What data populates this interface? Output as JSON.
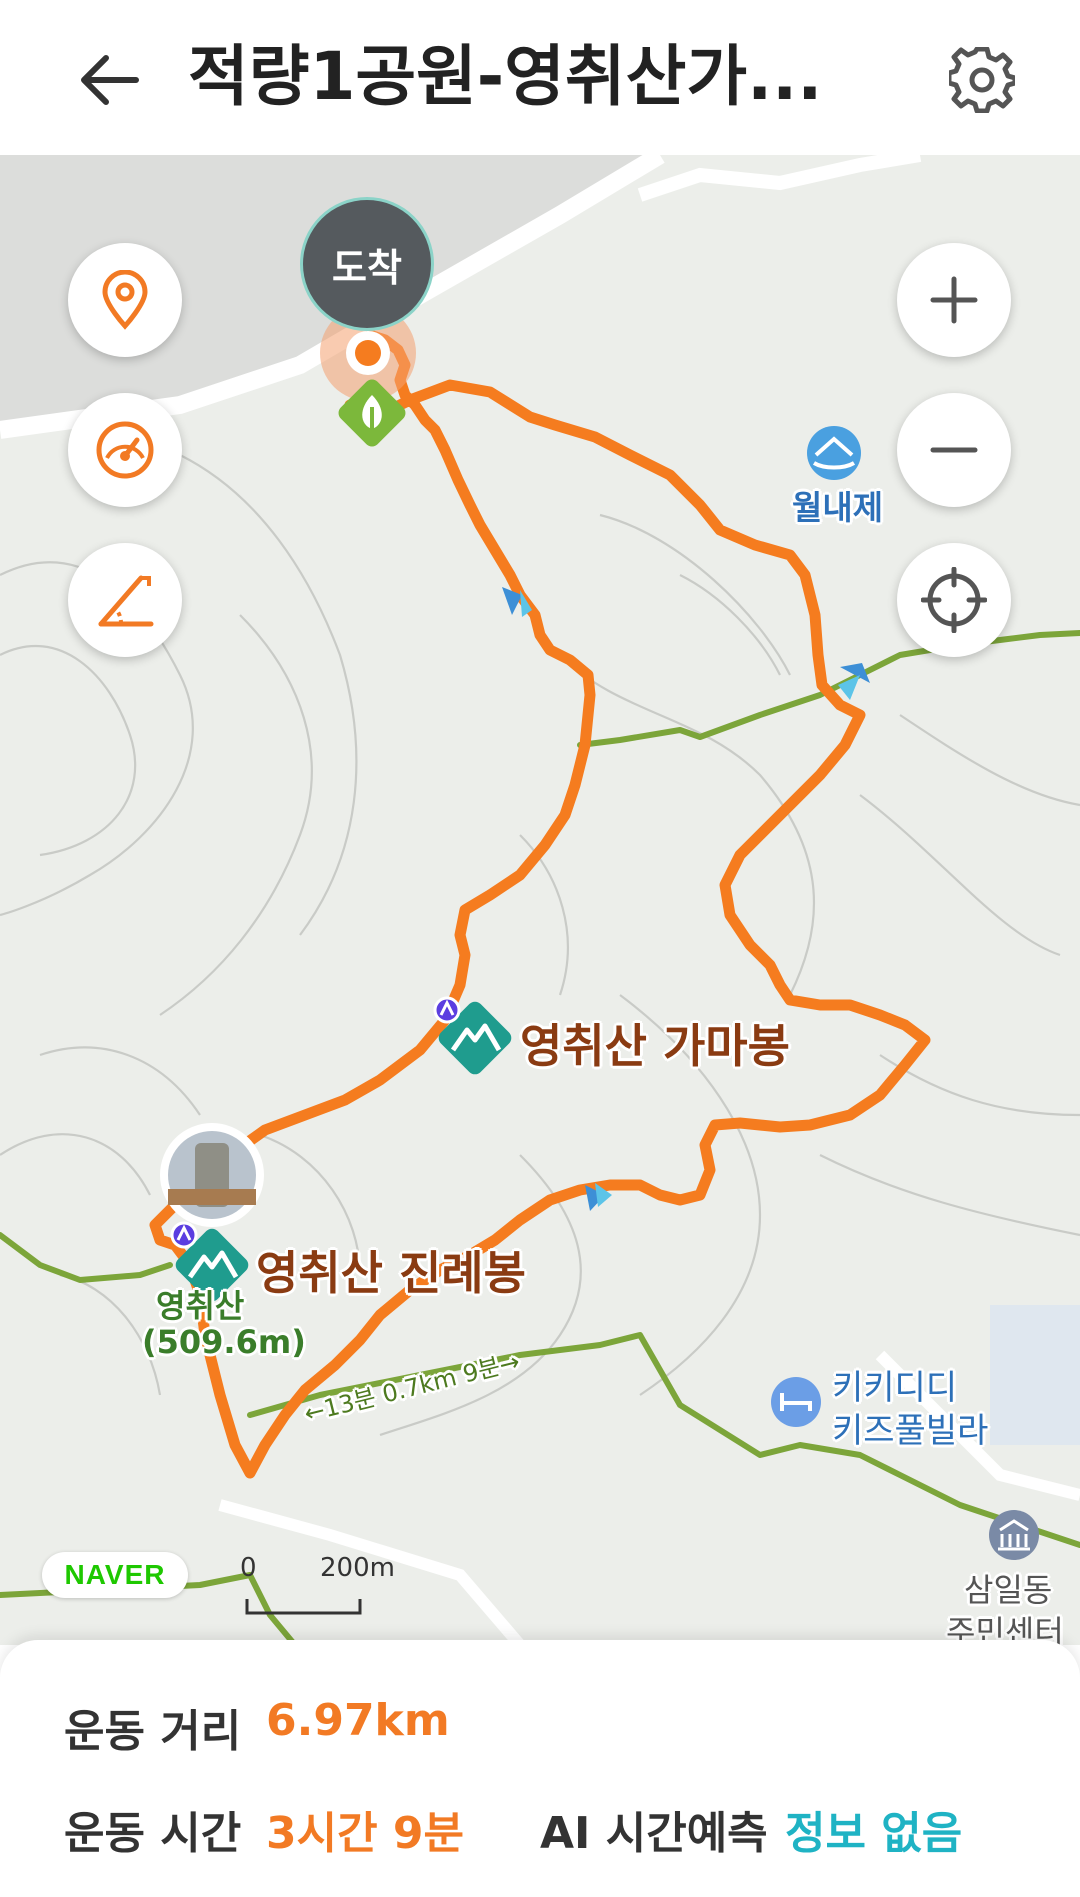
{
  "header": {
    "title": "적량1공원-영취산가...",
    "back_icon": "arrow-left-icon",
    "settings_icon": "gear-icon"
  },
  "map": {
    "arrival_label": "도착",
    "peak_gamabong": "영취산 가마봉",
    "peak_jinryebong": "영취산 진례봉",
    "summit_name": "영취산",
    "summit_elevation": "(509.6m)",
    "reservoir_label": "월내제",
    "villa_label": [
      "키키디디",
      "키즈풀빌라"
    ],
    "center_label": [
      "삼일동",
      "주민센터"
    ],
    "trail_sign": "←13분 0.7km 9분→",
    "naver_logo": "NAVER",
    "scale_zero": "0",
    "scale_distance": "200m"
  },
  "controls": {
    "location_icon": "map-pin-icon",
    "speed_icon": "speedometer-icon",
    "elevation_icon": "elevation-icon",
    "zoom_in_icon": "plus-icon",
    "zoom_out_icon": "minus-icon",
    "recenter_icon": "crosshair-icon"
  },
  "stats": {
    "distance_label": "운동 거리",
    "distance_value": "6.97km",
    "time_label": "운동 시간",
    "time_value": "3시간 9분",
    "ai_label": "AI 시간예측",
    "ai_value": "정보 없음"
  },
  "colors": {
    "accent": "#f27a24",
    "route": "#f57c1f",
    "trail_green": "#7ca53a",
    "peak_marker": "#1f9c8e",
    "peak_label": "#8a3b12",
    "ai_value": "#1fb3c4"
  }
}
